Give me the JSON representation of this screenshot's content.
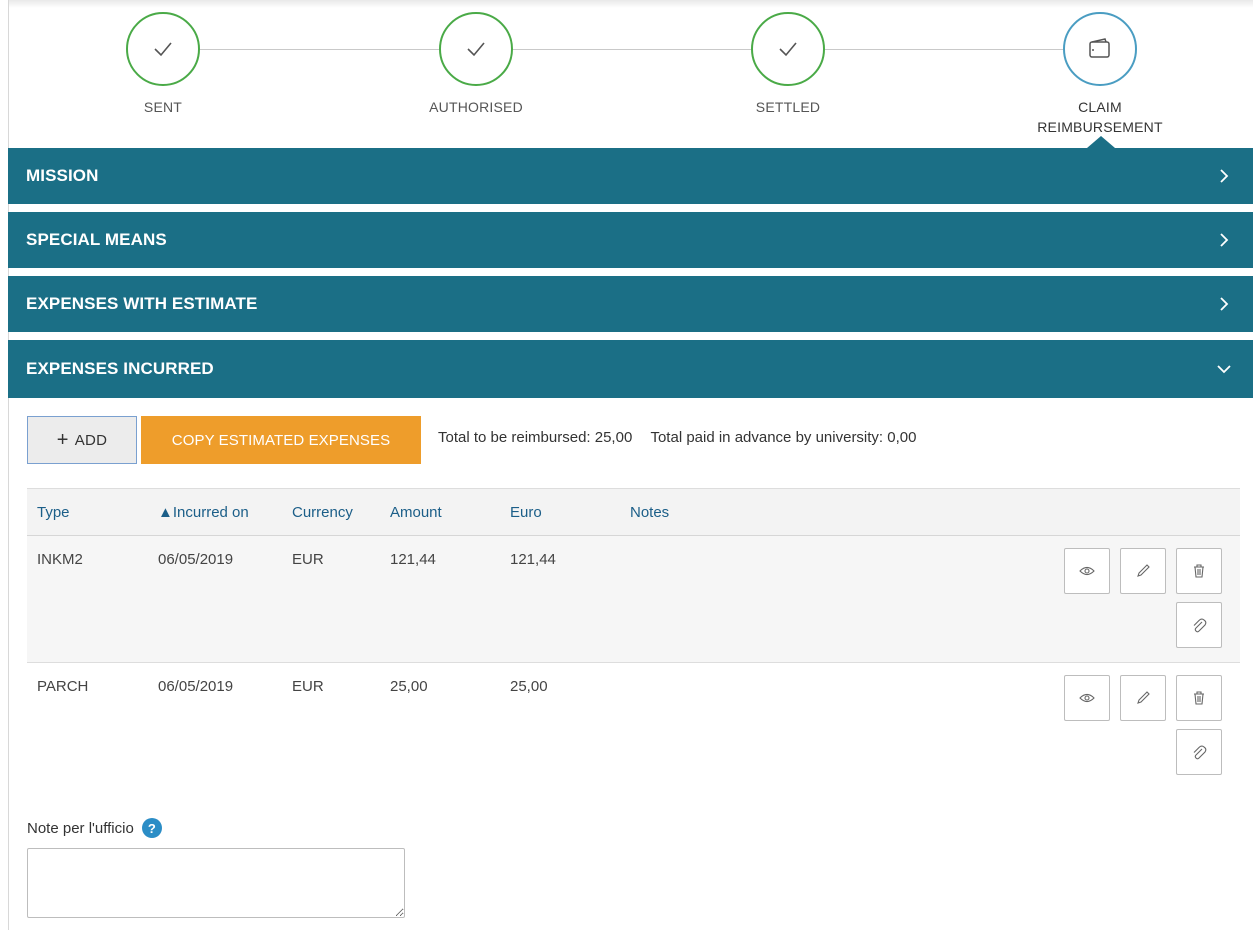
{
  "stepper": {
    "steps": [
      {
        "label": "SENT",
        "status": "done"
      },
      {
        "label": "AUTHORISED",
        "status": "done"
      },
      {
        "label": "SETTLED",
        "status": "done"
      },
      {
        "label_line1": "CLAIM",
        "label_line2": "REIMBURSEMENT",
        "status": "current"
      }
    ]
  },
  "panels": {
    "mission": {
      "title": "MISSION",
      "expanded": false
    },
    "special_means": {
      "title": "SPECIAL MEANS",
      "expanded": false
    },
    "expenses_estimate": {
      "title": "EXPENSES WITH ESTIMATE",
      "expanded": false
    },
    "expenses_incurred": {
      "title": "EXPENSES INCURRED",
      "expanded": true
    }
  },
  "toolbar": {
    "add_label": "ADD",
    "copy_label": "COPY ESTIMATED EXPENSES",
    "total_reimbursed": "Total to be reimbursed: 25,00",
    "total_advance": "Total paid in advance by university: 0,00"
  },
  "table": {
    "headers": {
      "type": "Type",
      "incurred_on": "▲Incurred on",
      "currency": "Currency",
      "amount": "Amount",
      "euro": "Euro",
      "notes": "Notes"
    },
    "rows": [
      {
        "type": "INKM2",
        "incurred_on": "06/05/2019",
        "currency": "EUR",
        "amount": "121,44",
        "euro": "121,44",
        "notes": ""
      },
      {
        "type": "PARCH",
        "incurred_on": "06/05/2019",
        "currency": "EUR",
        "amount": "25,00",
        "euro": "25,00",
        "notes": ""
      }
    ]
  },
  "note": {
    "label": "Note per l'ufficio",
    "help": "?",
    "value": ""
  },
  "colors": {
    "panel": "#1b6f86",
    "done": "#4aaa47",
    "current": "#4a9dc2",
    "copy_button": "#ee9d2b",
    "header_text": "#1b5e88"
  },
  "icons": {
    "done_step": "check-icon",
    "current_step": "wallet-icon",
    "collapsed": "chevron-right-icon",
    "expanded": "chevron-down-icon",
    "row_actions": [
      "eye-icon",
      "pencil-icon",
      "trash-icon",
      "paperclip-icon"
    ]
  }
}
